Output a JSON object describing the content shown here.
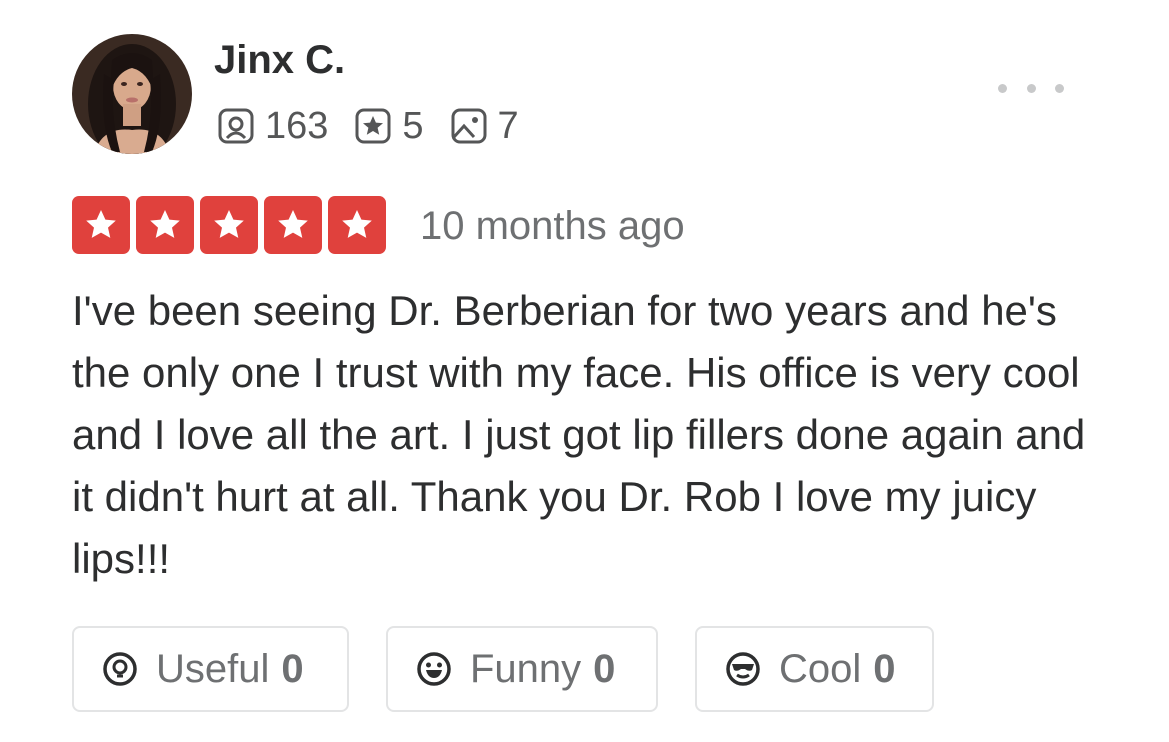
{
  "review": {
    "user": {
      "name": "Jinx C.",
      "avatar_icon": "user-avatar-photo",
      "stats": {
        "friends": "163",
        "reviews": "5",
        "photos": "7"
      }
    },
    "menu_icon": "more-dots-icon",
    "rating": 5,
    "rating_max": 5,
    "time_ago": "10 months ago",
    "text": "I've been seeing Dr. Berberian for two years and he's the only one I trust with my face. His office is very cool and I love all the art. I just got lip fillers done again and it didn't hurt at all. Thank you Dr. Rob I love my juicy lips!!!",
    "reactions": [
      {
        "label": "Useful",
        "count": "0",
        "icon": "lightbulb-icon"
      },
      {
        "label": "Funny",
        "count": "0",
        "icon": "smile-icon"
      },
      {
        "label": "Cool",
        "count": "0",
        "icon": "sunglasses-icon"
      }
    ]
  },
  "colors": {
    "star_red": "#e0413d",
    "text_dark": "#2d2e2f",
    "text_gray": "#6e7072",
    "border_gray": "#e3e4e5"
  }
}
